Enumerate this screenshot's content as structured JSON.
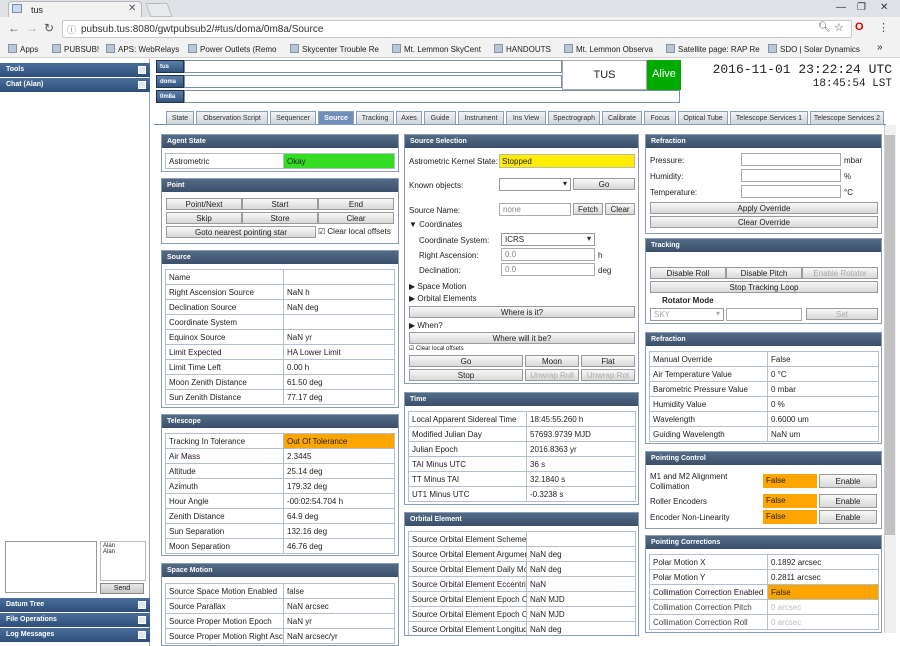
{
  "browser": {
    "tab_title": "tus",
    "url": "pubsub.tus:8080/gwtpubsub2/#tus/doma/0m8a/Source",
    "bookmarks": [
      "Apps",
      "PUBSUB!",
      "APS: WebRelays",
      "Power Outlets (Remo",
      "Skycenter Trouble Re",
      "Mt. Lemmon SkyCent",
      "HANDOUTS",
      "Mt. Lemmon Observa",
      "Satellite page: RAP Re",
      "SDO | Solar Dynamics"
    ]
  },
  "left": {
    "tools": "Tools",
    "chat": "Chat (Alan)",
    "chat_users": [
      "Alan",
      "Alan"
    ],
    "send": "Send",
    "datum_tree": "Datum Tree",
    "file_ops": "File Operations",
    "log": "Log Messages"
  },
  "header": {
    "labels": [
      "tus",
      "doma",
      "0m8a"
    ],
    "tus": "TUS",
    "alive": "Alive",
    "utc": "2016-11-01 23:22:24 UTC",
    "lst": "18:45:54 LST"
  },
  "tabs": [
    "State",
    "Observation Script",
    "Sequencer",
    "Source",
    "Tracking",
    "Axes",
    "Guide",
    "Instrument",
    "Ins View",
    "Spectrograph",
    "Calibrate",
    "Focus",
    "Optical Tube",
    "Telescope Services 1",
    "Telescope Services 2"
  ],
  "agent": {
    "title": "Agent State",
    "label": "Astrometric",
    "value": "Okay"
  },
  "point": {
    "title": "Point",
    "b1": "Point/Next",
    "b2": "Start",
    "b3": "End",
    "b4": "Skip",
    "b5": "Store",
    "b6": "Clear",
    "b7": "Goto nearest pointing star",
    "chk": "Clear local offsets"
  },
  "source": {
    "title": "Source",
    "rows": [
      [
        "Name",
        ""
      ],
      [
        "Right Ascension Source",
        "NaN h"
      ],
      [
        "Declination Source",
        "NaN deg"
      ],
      [
        "Coordinate System",
        ""
      ],
      [
        "Equinox Source",
        "NaN yr"
      ],
      [
        "Limit Expected",
        "HA Lower Limit"
      ],
      [
        "Limit Time Left",
        "0.00 h"
      ],
      [
        "Moon Zenith Distance",
        "61.50 deg"
      ],
      [
        "Sun Zenith Distance",
        "77.17 deg"
      ]
    ]
  },
  "telescope": {
    "title": "Telescope",
    "rows": [
      [
        "Tracking In Tolerance",
        "Out Of Tolerance"
      ],
      [
        "Air Mass",
        "2.3445"
      ],
      [
        "Altitude",
        "25.14 deg"
      ],
      [
        "Azimuth",
        "179.32 deg"
      ],
      [
        "Hour Angle",
        "-00:02:54.704 h"
      ],
      [
        "Zenith Distance",
        "64.9 deg"
      ],
      [
        "Sun Separation",
        "132.16 deg"
      ],
      [
        "Moon Separation",
        "46.76 deg"
      ]
    ]
  },
  "space": {
    "title": "Space Motion",
    "rows": [
      [
        "Source Space Motion Enabled",
        "false"
      ],
      [
        "Source Parallax",
        "NaN arcsec"
      ],
      [
        "Source Proper Motion Epoch",
        "NaN yr"
      ],
      [
        "Source Proper Motion Right Asc",
        "NaN arcsec/yr"
      ]
    ]
  },
  "sel": {
    "title": "Source Selection",
    "kernel_label": "Astrometric Kernel State:",
    "kernel_value": "Stopped",
    "known": "Known objects:",
    "go": "Go",
    "name_label": "Source Name:",
    "name_ph": "none",
    "fetch": "Fetch",
    "clear": "Clear",
    "coords": "Coordinates",
    "cs_label": "Coordinate System:",
    "cs_value": "ICRS",
    "ra_label": "Right Ascension:",
    "ra_value": "0.0",
    "ra_unit": "h",
    "dec_label": "Declination:",
    "dec_value": "0.0",
    "dec_unit": "deg",
    "space_motion": "Space Motion",
    "orbital": "Orbital Elements",
    "where_is": "Where is it?",
    "when": "When?",
    "where_will": "Where will it be?",
    "clear_local": "Clear local offsets",
    "go2": "Go",
    "moon": "Moon",
    "flat": "Flat",
    "stop": "Stop",
    "unwrap_roll": "Unwrap Roll",
    "unwrap_rot": "Unwrap Rot"
  },
  "time": {
    "title": "Time",
    "rows": [
      [
        "Local Apparent Sidereal Time",
        "18:45:55.260 h"
      ],
      [
        "Modified Julian Day",
        "57693.9739 MJD"
      ],
      [
        "Julian Epoch",
        "2016.8363 yr"
      ],
      [
        "TAI Minus UTC",
        "36 s"
      ],
      [
        "TT Minus TAI",
        "32.1840 s"
      ],
      [
        "UT1 Minus UTC",
        "-0.3238 s"
      ]
    ]
  },
  "orbital": {
    "title": "Orbital Element",
    "rows": [
      [
        "Source Orbital Element Scheme",
        ""
      ],
      [
        "Source Orbital Element Argumen",
        "NaN deg"
      ],
      [
        "Source Orbital Element Daily Mo",
        "NaN deg"
      ],
      [
        "Source Orbital Element Eccentric",
        "NaN"
      ],
      [
        "Source Orbital Element Epoch O",
        "NaN MJD"
      ],
      [
        "Source Orbital Element Epoch O",
        "NaN MJD"
      ],
      [
        "Source Orbital Element Longitud",
        "NaN deg"
      ]
    ]
  },
  "refr": {
    "title": "Refraction",
    "pressure": "Pressure:",
    "pressure_unit": "mbar",
    "humidity": "Humidity:",
    "humidity_unit": "%",
    "temp": "Temperature:",
    "temp_unit": "°C",
    "apply": "Apply Override",
    "clear": "Clear Override"
  },
  "tracking": {
    "title": "Tracking",
    "disable_roll": "Disable Roll",
    "disable_pitch": "Disable Pitch",
    "enable_rotator": "Enable Rotator",
    "stop": "Stop Tracking Loop",
    "rotator_mode": "Rotator Mode",
    "mode_value": "SKY",
    "set": "Set"
  },
  "refr2": {
    "title": "Refraction",
    "rows": [
      [
        "Manual Override",
        "False"
      ],
      [
        "Air Temperature Value",
        "0 °C"
      ],
      [
        "Barometric Pressure Value",
        "0 mbar"
      ],
      [
        "Humidity Value",
        "0 %"
      ],
      [
        "Wavelength",
        "0.6000 um"
      ],
      [
        "Guiding Wavelength",
        "NaN um"
      ]
    ]
  },
  "pc": {
    "title": "Pointing Control",
    "rows": [
      [
        "M1 and M2 Alignment Collimation",
        "False",
        "Enable"
      ],
      [
        "Roller Encoders",
        "False",
        "Enable"
      ],
      [
        "Encoder Non-Linearity",
        "False",
        "Enable"
      ]
    ]
  },
  "corr": {
    "title": "Pointing Corrections",
    "rows": [
      [
        "Polar Motion X",
        "0.1892 arcsec"
      ],
      [
        "Polar Motion Y",
        "0.2811 arcsec"
      ],
      [
        "Collimation Correction Enabled",
        "False"
      ],
      [
        "Collimation Correction Pitch",
        "0 arcsec"
      ],
      [
        "Collimation Correction Roll",
        "0 arcsec"
      ]
    ]
  }
}
